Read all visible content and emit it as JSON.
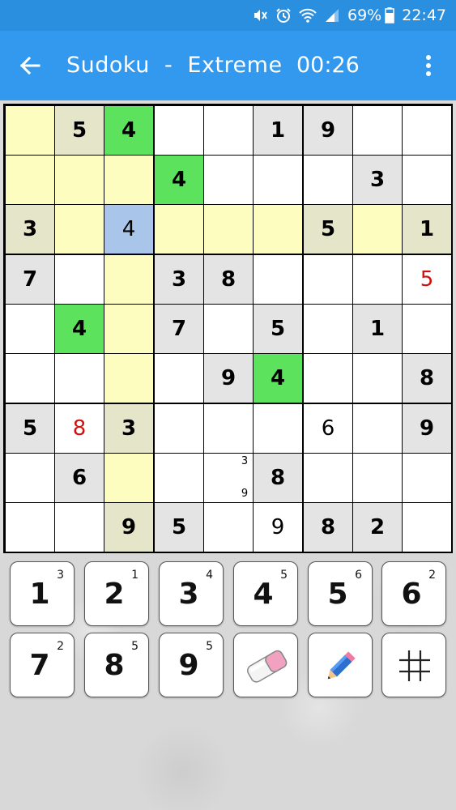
{
  "status_bar": {
    "battery_percent": "69%",
    "time": "22:47",
    "icons": [
      "mute-icon",
      "alarm-icon",
      "wifi-icon",
      "signal-icon",
      "battery-icon"
    ]
  },
  "app_bar": {
    "title": "Sudoku  -  Extreme",
    "timer": "00:26",
    "back_icon": "arrow-left-icon",
    "menu_icon": "more-vert-icon"
  },
  "colors": {
    "given_bg": "#e4e4e4",
    "empty_bg": "#ffffff",
    "highlight": "#fdfdbf",
    "highlight_given": "#e5e5c9",
    "same_number": "#5de25d",
    "selected": "#a9c5ea",
    "error_text": "#d01010"
  },
  "grid": {
    "cells": [
      [
        {
          "v": "",
          "t": "empty",
          "h": "hl"
        },
        {
          "v": "5",
          "t": "given",
          "h": "hl"
        },
        {
          "v": "4",
          "t": "given",
          "h": "same"
        },
        {
          "v": "",
          "t": "empty"
        },
        {
          "v": "",
          "t": "empty"
        },
        {
          "v": "1",
          "t": "given"
        },
        {
          "v": "9",
          "t": "given"
        },
        {
          "v": "",
          "t": "empty"
        },
        {
          "v": "",
          "t": "empty"
        }
      ],
      [
        {
          "v": "",
          "t": "empty",
          "h": "hl"
        },
        {
          "v": "",
          "t": "empty",
          "h": "hl"
        },
        {
          "v": "",
          "t": "empty",
          "h": "hl"
        },
        {
          "v": "4",
          "t": "given",
          "h": "same"
        },
        {
          "v": "",
          "t": "empty"
        },
        {
          "v": "",
          "t": "empty"
        },
        {
          "v": "",
          "t": "empty"
        },
        {
          "v": "3",
          "t": "given"
        },
        {
          "v": "",
          "t": "empty"
        }
      ],
      [
        {
          "v": "3",
          "t": "given",
          "h": "hl"
        },
        {
          "v": "",
          "t": "empty",
          "h": "hl"
        },
        {
          "v": "4",
          "t": "entered",
          "h": "sel"
        },
        {
          "v": "",
          "t": "empty",
          "h": "hl"
        },
        {
          "v": "",
          "t": "empty",
          "h": "hl"
        },
        {
          "v": "",
          "t": "empty",
          "h": "hl"
        },
        {
          "v": "5",
          "t": "given",
          "h": "hl"
        },
        {
          "v": "",
          "t": "empty",
          "h": "hl"
        },
        {
          "v": "1",
          "t": "given",
          "h": "hl"
        }
      ],
      [
        {
          "v": "7",
          "t": "given"
        },
        {
          "v": "",
          "t": "empty"
        },
        {
          "v": "",
          "t": "empty",
          "h": "hl"
        },
        {
          "v": "3",
          "t": "given"
        },
        {
          "v": "8",
          "t": "given"
        },
        {
          "v": "",
          "t": "empty"
        },
        {
          "v": "",
          "t": "empty"
        },
        {
          "v": "",
          "t": "empty"
        },
        {
          "v": "5",
          "t": "entered",
          "e": true
        }
      ],
      [
        {
          "v": "",
          "t": "empty"
        },
        {
          "v": "4",
          "t": "given",
          "h": "same"
        },
        {
          "v": "",
          "t": "empty",
          "h": "hl"
        },
        {
          "v": "7",
          "t": "given"
        },
        {
          "v": "",
          "t": "empty"
        },
        {
          "v": "5",
          "t": "given"
        },
        {
          "v": "",
          "t": "empty"
        },
        {
          "v": "1",
          "t": "given"
        },
        {
          "v": "",
          "t": "empty"
        }
      ],
      [
        {
          "v": "",
          "t": "empty"
        },
        {
          "v": "",
          "t": "empty"
        },
        {
          "v": "",
          "t": "empty",
          "h": "hl"
        },
        {
          "v": "",
          "t": "empty"
        },
        {
          "v": "9",
          "t": "given"
        },
        {
          "v": "4",
          "t": "given",
          "h": "same"
        },
        {
          "v": "",
          "t": "empty"
        },
        {
          "v": "",
          "t": "empty"
        },
        {
          "v": "8",
          "t": "given"
        }
      ],
      [
        {
          "v": "5",
          "t": "given"
        },
        {
          "v": "8",
          "t": "entered",
          "e": true
        },
        {
          "v": "3",
          "t": "given",
          "h": "hl"
        },
        {
          "v": "",
          "t": "empty"
        },
        {
          "v": "",
          "t": "empty"
        },
        {
          "v": "",
          "t": "empty"
        },
        {
          "v": "6",
          "t": "entered"
        },
        {
          "v": "",
          "t": "empty"
        },
        {
          "v": "9",
          "t": "given"
        }
      ],
      [
        {
          "v": "",
          "t": "empty"
        },
        {
          "v": "6",
          "t": "given"
        },
        {
          "v": "",
          "t": "empty",
          "h": "hl"
        },
        {
          "v": "",
          "t": "empty"
        },
        {
          "v": "",
          "t": "empty",
          "n": [
            "3",
            "9"
          ]
        },
        {
          "v": "8",
          "t": "given"
        },
        {
          "v": "",
          "t": "empty"
        },
        {
          "v": "",
          "t": "empty"
        },
        {
          "v": "",
          "t": "empty"
        }
      ],
      [
        {
          "v": "",
          "t": "empty"
        },
        {
          "v": "",
          "t": "empty"
        },
        {
          "v": "9",
          "t": "given",
          "h": "hl"
        },
        {
          "v": "5",
          "t": "given"
        },
        {
          "v": "",
          "t": "empty"
        },
        {
          "v": "9",
          "t": "entered"
        },
        {
          "v": "8",
          "t": "given"
        },
        {
          "v": "2",
          "t": "given"
        },
        {
          "v": "",
          "t": "empty"
        }
      ]
    ]
  },
  "keypad": {
    "digits": [
      {
        "digit": "1",
        "count": "3"
      },
      {
        "digit": "2",
        "count": "1"
      },
      {
        "digit": "3",
        "count": "4"
      },
      {
        "digit": "4",
        "count": "5"
      },
      {
        "digit": "5",
        "count": "6"
      },
      {
        "digit": "6",
        "count": "2"
      },
      {
        "digit": "7",
        "count": "2"
      },
      {
        "digit": "8",
        "count": "5"
      },
      {
        "digit": "9",
        "count": "5"
      }
    ],
    "tools": [
      {
        "name": "eraser-button",
        "icon": "eraser-icon"
      },
      {
        "name": "pencil-button",
        "icon": "pencil-icon"
      },
      {
        "name": "notes-grid-button",
        "icon": "hash-icon"
      }
    ]
  }
}
